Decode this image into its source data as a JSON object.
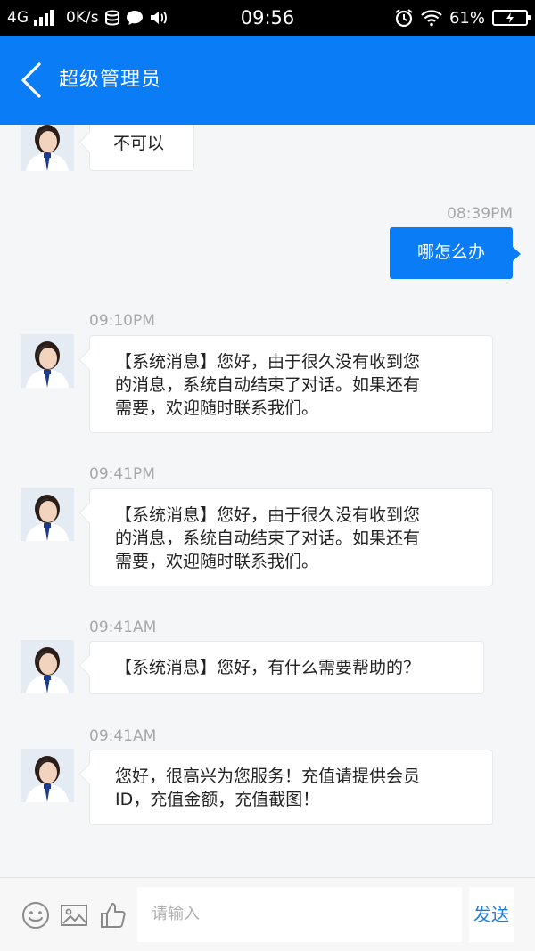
{
  "status_bar": {
    "network": "4G",
    "speed": "0K/s",
    "time": "09:56",
    "battery": "61%"
  },
  "header": {
    "title": "超级管理员"
  },
  "messages": [
    {
      "side": "in",
      "text": "不可以"
    },
    {
      "side": "out",
      "time": "08:39PM",
      "text": "哪怎么办"
    },
    {
      "side": "in",
      "time": "09:10PM",
      "lines": [
        "【系统消息】您好，由于很久没有收到您",
        "的消息，系统自动结束了对话。如果还有",
        "需要，欢迎随时联系我们。"
      ]
    },
    {
      "side": "in",
      "time": "09:41PM",
      "lines": [
        "【系统消息】您好，由于很久没有收到您",
        "的消息，系统自动结束了对话。如果还有",
        "需要，欢迎随时联系我们。"
      ]
    },
    {
      "side": "in",
      "time": "09:41AM",
      "text": "【系统消息】您好，有什么需要帮助的？"
    },
    {
      "side": "in",
      "time": "09:41AM",
      "lines": [
        "您好，很高兴为您服务！充值请提供会员",
        "ID，充值金额，充值截图！"
      ]
    }
  ],
  "input_bar": {
    "placeholder": "请输入",
    "send_label": "发送"
  },
  "colors": {
    "accent": "#0a7cf5",
    "background": "#f5f6f8",
    "timestamp": "#a8a8a8"
  },
  "icons": [
    "back-chevron-icon",
    "emoji-icon",
    "image-icon",
    "thumbs-up-icon",
    "agent-avatar"
  ]
}
